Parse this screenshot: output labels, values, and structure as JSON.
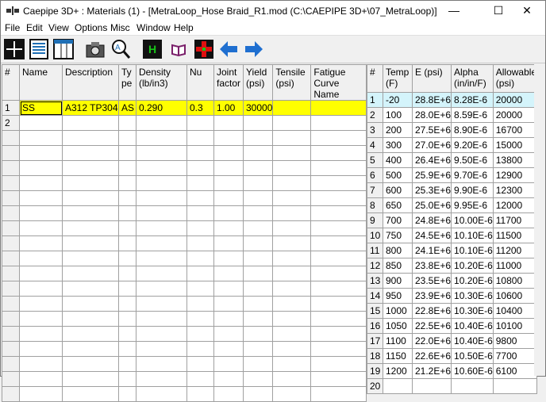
{
  "window": {
    "title": "Caepipe 3D+ : Materials  (1)  -  [MetraLoop_Hose Braid_R1.mod (C:\\CAEPIPE 3D+\\07_MetraLoop)]"
  },
  "menu": [
    "File",
    "Edit",
    "View",
    "Options",
    "Misc",
    "Window",
    "Help"
  ],
  "toolbar_icons": [
    "plus-grid-icon",
    "document-icon",
    "table-icon",
    "camera-icon",
    "magnify-icon",
    "h-icon",
    "book-icon",
    "red-cross-icon",
    "arrow-left-icon",
    "arrow-right-icon"
  ],
  "materials": {
    "headers": [
      "#",
      "Name",
      "Description",
      "Ty pe",
      "Density (lb/in3)",
      "Nu",
      "Joint factor",
      "Yield (psi)",
      "Tensile (psi)",
      "Fatigue Curve Name"
    ],
    "rows": [
      [
        "1",
        "SS",
        "A312 TP304",
        "AS",
        "0.290",
        "0.3",
        "1.00",
        "30000",
        "",
        ""
      ],
      [
        "2",
        "",
        "",
        "",
        "",
        "",
        "",
        "",
        "",
        ""
      ],
      [
        "",
        "",
        "",
        "",
        "",
        "",
        "",
        "",
        "",
        ""
      ],
      [
        "",
        "",
        "",
        "",
        "",
        "",
        "",
        "",
        "",
        ""
      ],
      [
        "",
        "",
        "",
        "",
        "",
        "",
        "",
        "",
        "",
        ""
      ],
      [
        "",
        "",
        "",
        "",
        "",
        "",
        "",
        "",
        "",
        ""
      ],
      [
        "",
        "",
        "",
        "",
        "",
        "",
        "",
        "",
        "",
        ""
      ],
      [
        "",
        "",
        "",
        "",
        "",
        "",
        "",
        "",
        "",
        ""
      ],
      [
        "",
        "",
        "",
        "",
        "",
        "",
        "",
        "",
        "",
        ""
      ],
      [
        "",
        "",
        "",
        "",
        "",
        "",
        "",
        "",
        "",
        ""
      ],
      [
        "",
        "",
        "",
        "",
        "",
        "",
        "",
        "",
        "",
        ""
      ],
      [
        "",
        "",
        "",
        "",
        "",
        "",
        "",
        "",
        "",
        ""
      ],
      [
        "",
        "",
        "",
        "",
        "",
        "",
        "",
        "",
        "",
        ""
      ],
      [
        "",
        "",
        "",
        "",
        "",
        "",
        "",
        "",
        "",
        ""
      ],
      [
        "",
        "",
        "",
        "",
        "",
        "",
        "",
        "",
        "",
        ""
      ],
      [
        "",
        "",
        "",
        "",
        "",
        "",
        "",
        "",
        "",
        ""
      ],
      [
        "",
        "",
        "",
        "",
        "",
        "",
        "",
        "",
        "",
        ""
      ],
      [
        "",
        "",
        "",
        "",
        "",
        "",
        "",
        "",
        "",
        ""
      ],
      [
        "",
        "",
        "",
        "",
        "",
        "",
        "",
        "",
        "",
        ""
      ],
      [
        "",
        "",
        "",
        "",
        "",
        "",
        "",
        "",
        "",
        ""
      ]
    ]
  },
  "properties": {
    "headers": [
      "#",
      "Temp (F)",
      "E (psi)",
      "Alpha (in/in/F)",
      "Allowable (psi)"
    ],
    "rows": [
      [
        "1",
        "-20",
        "28.8E+6",
        "8.28E-6",
        "20000"
      ],
      [
        "2",
        "100",
        "28.0E+6",
        "8.59E-6",
        "20000"
      ],
      [
        "3",
        "200",
        "27.5E+6",
        "8.90E-6",
        "16700"
      ],
      [
        "4",
        "300",
        "27.0E+6",
        "9.20E-6",
        "15000"
      ],
      [
        "5",
        "400",
        "26.4E+6",
        "9.50E-6",
        "13800"
      ],
      [
        "6",
        "500",
        "25.9E+6",
        "9.70E-6",
        "12900"
      ],
      [
        "7",
        "600",
        "25.3E+6",
        "9.90E-6",
        "12300"
      ],
      [
        "8",
        "650",
        "25.0E+6",
        "9.95E-6",
        "12000"
      ],
      [
        "9",
        "700",
        "24.8E+6",
        "10.00E-6",
        "11700"
      ],
      [
        "10",
        "750",
        "24.5E+6",
        "10.10E-6",
        "11500"
      ],
      [
        "11",
        "800",
        "24.1E+6",
        "10.10E-6",
        "11200"
      ],
      [
        "12",
        "850",
        "23.8E+6",
        "10.20E-6",
        "11000"
      ],
      [
        "13",
        "900",
        "23.5E+6",
        "10.20E-6",
        "10800"
      ],
      [
        "14",
        "950",
        "23.9E+6",
        "10.30E-6",
        "10600"
      ],
      [
        "15",
        "1000",
        "22.8E+6",
        "10.30E-6",
        "10400"
      ],
      [
        "16",
        "1050",
        "22.5E+6",
        "10.40E-6",
        "10100"
      ],
      [
        "17",
        "1100",
        "22.0E+6",
        "10.40E-6",
        "9800"
      ],
      [
        "18",
        "1150",
        "22.6E+6",
        "10.50E-6",
        "7700"
      ],
      [
        "19",
        "1200",
        "21.2E+6",
        "10.60E-6",
        "6100"
      ],
      [
        "20",
        "",
        "",
        "",
        ""
      ]
    ]
  },
  "colors": {
    "selected_row": "#ffff00",
    "selected_prop_row": "#d4f4fb"
  }
}
